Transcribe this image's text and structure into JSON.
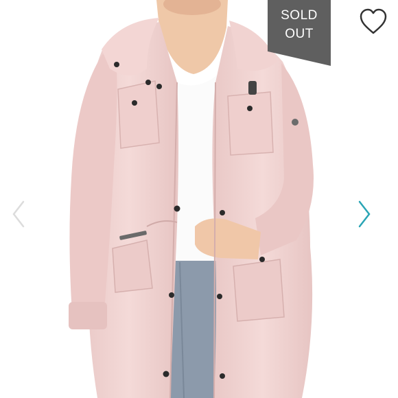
{
  "listing": {
    "badge": {
      "line1": "SOLD",
      "line2": "OUT",
      "background": "#5f5f5f",
      "text_color": "#ffffff"
    },
    "like_icon": "heart-outline-icon",
    "prev_icon": "chevron-left-icon",
    "next_icon": "chevron-right-icon",
    "colors": {
      "jacket": "#f1d4d2",
      "arrow_prev": "#dcdcdc",
      "arrow_next": "#2aa5b5",
      "heart_stroke": "#333333"
    }
  }
}
